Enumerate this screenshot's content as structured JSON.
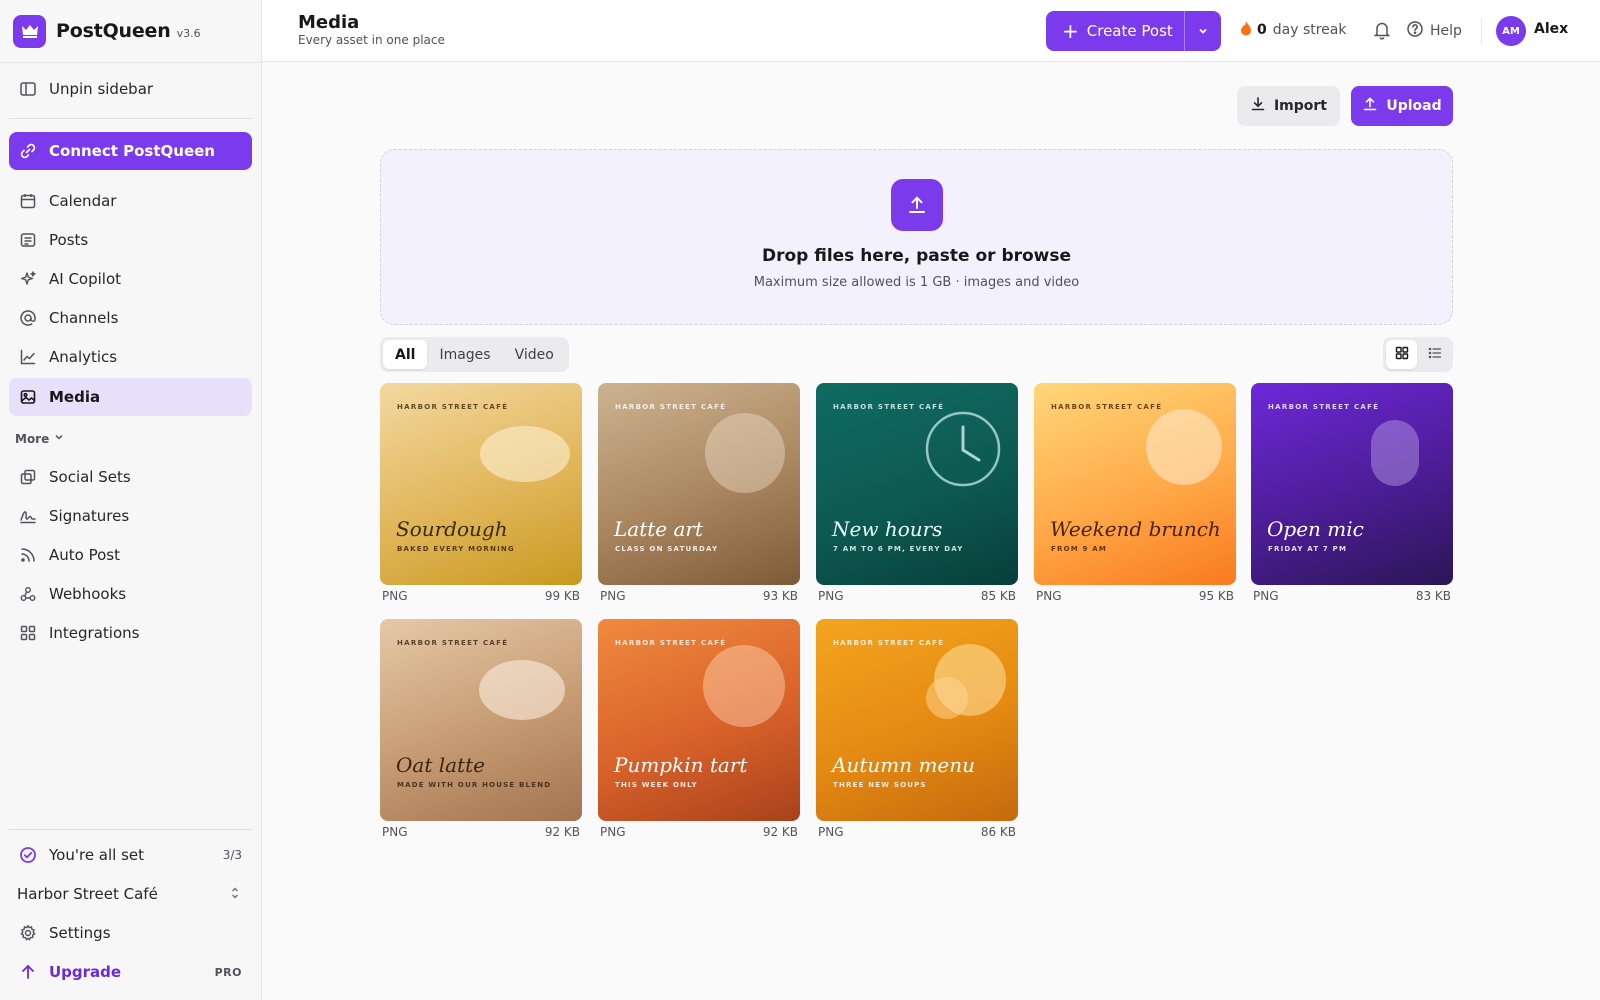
{
  "app": {
    "name": "PostQueen",
    "version": "v3.6"
  },
  "sidebar": {
    "unpin": "Unpin sidebar",
    "connect": "Connect PostQueen",
    "nav": [
      {
        "label": "Calendar",
        "icon": "calendar-icon"
      },
      {
        "label": "Posts",
        "icon": "posts-icon"
      },
      {
        "label": "AI Copilot",
        "icon": "sparkles-icon"
      },
      {
        "label": "Channels",
        "icon": "at-sign-icon"
      },
      {
        "label": "Analytics",
        "icon": "chart-icon"
      },
      {
        "label": "Media",
        "icon": "image-icon",
        "active": true
      }
    ],
    "more_label": "More",
    "more": [
      {
        "label": "Social Sets",
        "icon": "copy-icon"
      },
      {
        "label": "Signatures",
        "icon": "signature-icon"
      },
      {
        "label": "Auto Post",
        "icon": "rss-icon"
      },
      {
        "label": "Webhooks",
        "icon": "webhook-icon"
      },
      {
        "label": "Integrations",
        "icon": "grid-icon"
      }
    ],
    "setup": {
      "label": "You're all set",
      "count": "3/3"
    },
    "workspace": "Harbor Street Café",
    "settings": "Settings",
    "upgrade": {
      "label": "Upgrade",
      "badge": "PRO"
    }
  },
  "header": {
    "title": "Media",
    "subtitle": "Every asset in one place",
    "create_post": "Create Post",
    "streak_count": "0",
    "streak_label": "day streak",
    "help": "Help",
    "avatar_initials": "AM",
    "username": "Alex"
  },
  "actions": {
    "import": "Import",
    "upload": "Upload"
  },
  "dropzone": {
    "title": "Drop files here, paste or browse",
    "subtitle": "Maximum size allowed is 1 GB · images and video"
  },
  "filters": {
    "all": "All",
    "images": "Images",
    "video": "Video",
    "active": "All"
  },
  "view_mode": "grid",
  "media": [
    {
      "brand": "HARBOR STREET CAFÉ",
      "title": "Sourdough",
      "subtitle": "BAKED EVERY MORNING",
      "type": "PNG",
      "size": "99 KB"
    },
    {
      "brand": "HARBOR STREET CAFÉ",
      "title": "Latte art",
      "subtitle": "CLASS ON SATURDAY",
      "type": "PNG",
      "size": "93 KB"
    },
    {
      "brand": "HARBOR STREET CAFÉ",
      "title": "New hours",
      "subtitle": "7 AM TO 6 PM, EVERY DAY",
      "type": "PNG",
      "size": "85 KB"
    },
    {
      "brand": "HARBOR STREET CAFÉ",
      "title": "Weekend brunch",
      "subtitle": "FROM 9 AM",
      "type": "PNG",
      "size": "95 KB"
    },
    {
      "brand": "HARBOR STREET CAFÉ",
      "title": "Open mic",
      "subtitle": "FRIDAY AT 7 PM",
      "type": "PNG",
      "size": "83 KB"
    },
    {
      "brand": "HARBOR STREET CAFÉ",
      "title": "Oat latte",
      "subtitle": "MADE WITH OUR HOUSE BLEND",
      "type": "PNG",
      "size": "92 KB"
    },
    {
      "brand": "HARBOR STREET CAFÉ",
      "title": "Pumpkin tart",
      "subtitle": "THIS WEEK ONLY",
      "type": "PNG",
      "size": "92 KB"
    },
    {
      "brand": "HARBOR STREET CAFÉ",
      "title": "Autumn menu",
      "subtitle": "THREE NEW SOUPS",
      "type": "PNG",
      "size": "86 KB"
    }
  ],
  "colors": {
    "accent": "#7c3aed",
    "active_nav_bg": "#e7e0fa",
    "flame": "#f97316"
  }
}
